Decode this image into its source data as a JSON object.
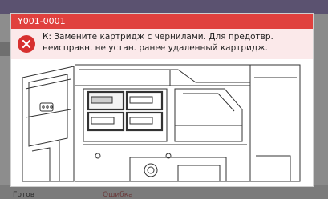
{
  "background": {
    "status_left": "Готов",
    "status_right": "Ошибка"
  },
  "dialog": {
    "code": "Y001-0001",
    "message": "К: Замените картридж с чернилами. Для предотвр. неисправн. не устан. ранее удаленный картридж.",
    "accent_color": "#e0413e",
    "message_bg": "#fbe9ea",
    "icon": "error-x-icon"
  }
}
